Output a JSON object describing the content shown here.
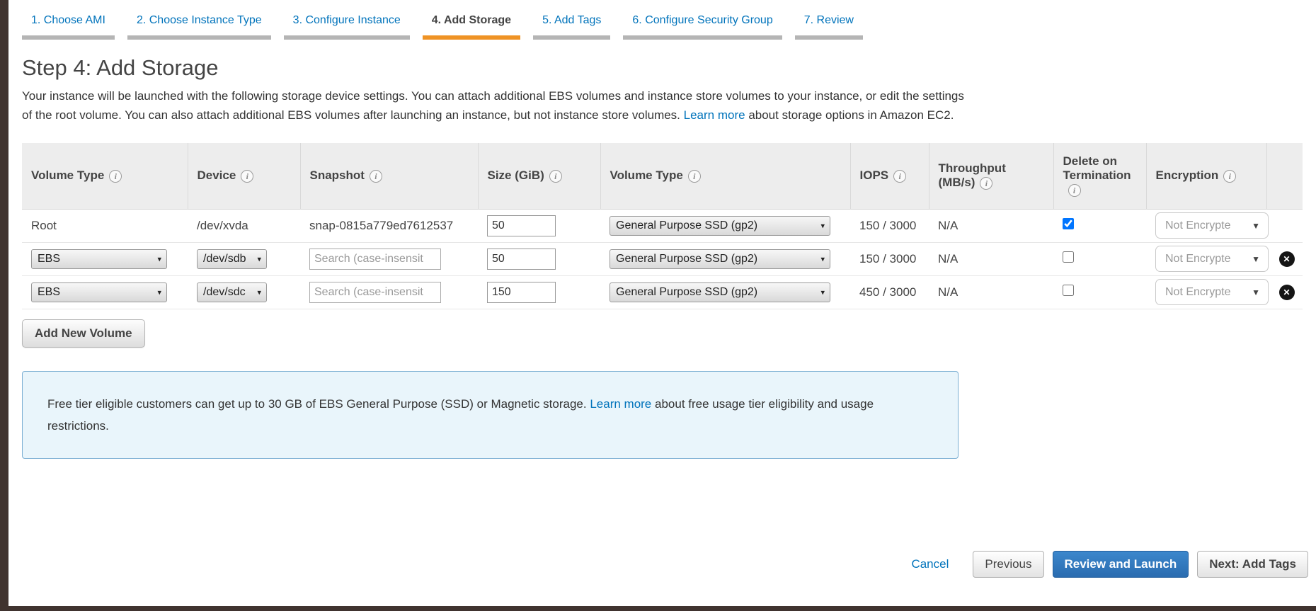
{
  "icons": {
    "info": "i",
    "dropdown_arrow": "▾",
    "enc_arrow": "▼",
    "delete": "✕"
  },
  "tabs": [
    {
      "label": "1. Choose AMI"
    },
    {
      "label": "2. Choose Instance Type"
    },
    {
      "label": "3. Configure Instance"
    },
    {
      "label": "4. Add Storage"
    },
    {
      "label": "5. Add Tags"
    },
    {
      "label": "6. Configure Security Group"
    },
    {
      "label": "7. Review"
    }
  ],
  "header": {
    "title": "Step 4: Add Storage",
    "description": "Your instance will be launched with the following storage device settings. You can attach additional EBS volumes and instance store volumes to your instance, or edit the settings of the root volume. You can also attach additional EBS volumes after launching an instance, but not instance store volumes.",
    "learn_more": "Learn more",
    "description_after": "about storage options in Amazon EC2."
  },
  "table": {
    "columns": [
      {
        "label": "Volume Type"
      },
      {
        "label": "Device"
      },
      {
        "label": "Snapshot"
      },
      {
        "label": "Size (GiB)"
      },
      {
        "label": "Volume Type"
      },
      {
        "label": "IOPS"
      },
      {
        "label": "Throughput",
        "label2": "(MB/s)"
      },
      {
        "label": "Delete on Termination"
      },
      {
        "label": "Encryption"
      }
    ],
    "rows": [
      {
        "volume_type": "Root",
        "device": "/dev/xvda",
        "snapshot": "snap-0815a779ed7612537",
        "size": "50",
        "type": "General Purpose SSD (gp2)",
        "iops": "150 / 3000",
        "throughput": "N/A",
        "delete_on_termination": true,
        "encryption": "Not Encrypte"
      },
      {
        "volume_type": "EBS",
        "device": "/dev/sdb",
        "snapshot_placeholder": "Search (case-insensit",
        "size": "50",
        "type": "General Purpose SSD (gp2)",
        "iops": "150 / 3000",
        "throughput": "N/A",
        "delete_on_termination": false,
        "encryption": "Not Encrypte"
      },
      {
        "volume_type": "EBS",
        "device": "/dev/sdc",
        "snapshot_placeholder": "Search (case-insensit",
        "size": "150",
        "type": "General Purpose SSD (gp2)",
        "iops": "450 / 3000",
        "throughput": "N/A",
        "delete_on_termination": false,
        "encryption": "Not Encrypte"
      }
    ]
  },
  "add_new_volume_label": "Add New Volume",
  "free_tier": {
    "text_before": "Free tier eligible customers can get up to 30 GB of EBS General Purpose (SSD) or Magnetic storage.",
    "learn_more": "Learn more",
    "text_after": "about free usage tier eligibility and usage restrictions."
  },
  "footer_actions": {
    "cancel": "Cancel",
    "previous": "Previous",
    "review_and_launch": "Review and Launch",
    "next": "Next: Add Tags"
  }
}
